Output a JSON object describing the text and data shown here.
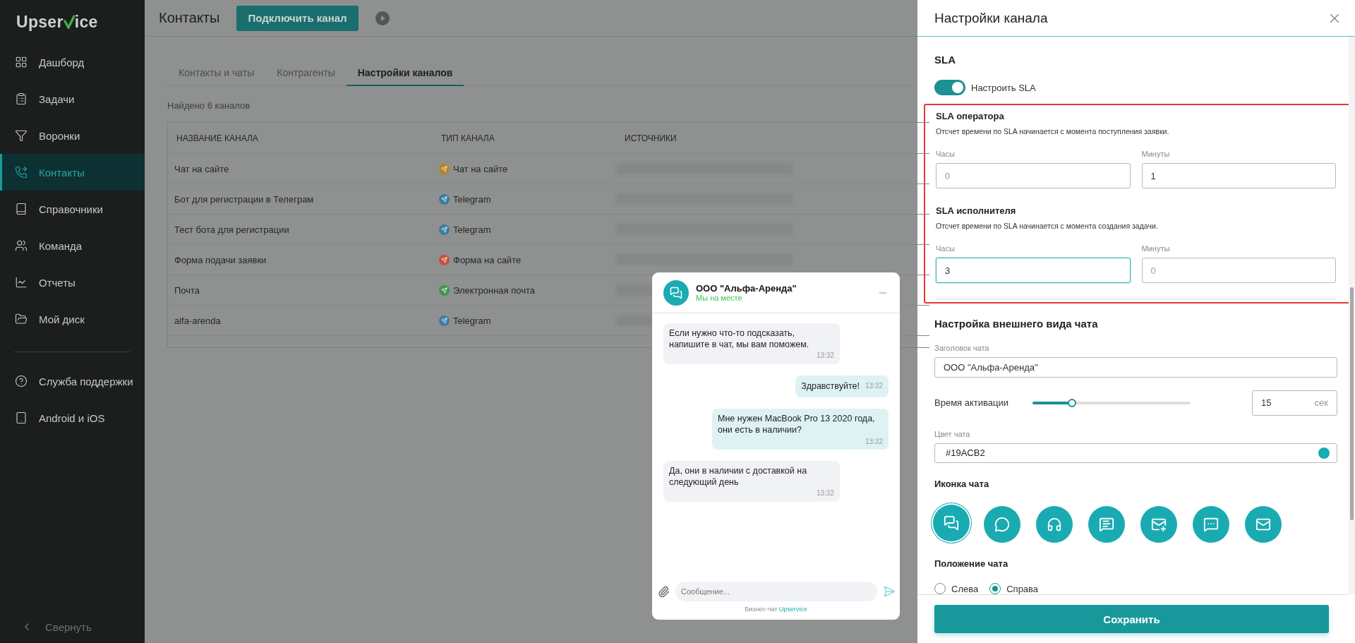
{
  "sidebar": {
    "logo": {
      "before": "Upser",
      "after": "ice"
    },
    "items": [
      {
        "label": "Дашборд",
        "selected": false
      },
      {
        "label": "Задачи",
        "selected": false
      },
      {
        "label": "Воронки",
        "selected": false
      },
      {
        "label": "Контакты",
        "selected": true
      },
      {
        "label": "Справочники",
        "selected": false
      },
      {
        "label": "Команда",
        "selected": false
      },
      {
        "label": "Отчеты",
        "selected": false
      },
      {
        "label": "Мой диск",
        "selected": false
      }
    ],
    "extra_items": [
      {
        "label": "Служба поддержки",
        "selected": false
      },
      {
        "label": "Android и iOS",
        "selected": false
      }
    ],
    "collapse": "Свернуть"
  },
  "header": {
    "title": "Контакты",
    "connect_button": "Подключить канал"
  },
  "tabs": [
    {
      "label": "Контакты и чаты",
      "selected": false
    },
    {
      "label": "Контрагенты",
      "selected": false
    },
    {
      "label": "Настройки каналов",
      "selected": true
    }
  ],
  "found": "Найдено 6 каналов",
  "table": {
    "columns": [
      "НАЗВАНИЕ КАНАЛА",
      "ТИП КАНАЛА",
      "ИСТОЧНИКИ"
    ],
    "rows": [
      {
        "name": "Чат на сайте",
        "type": "Чат на сайте",
        "color": "#b9831f",
        "sources_hidden": true
      },
      {
        "name": "Бот для регистрации в Телеграм",
        "type": "Telegram",
        "color": "#3a7ca6",
        "sources_hidden": true
      },
      {
        "name": "Тест бота для регистрации",
        "type": "Telegram",
        "color": "#3a7ca6",
        "sources_hidden": true
      },
      {
        "name": "Форма подачи заявки",
        "type": "Форма на сайте",
        "color": "#c0553a",
        "sources_hidden": true
      },
      {
        "name": "Почта",
        "type": "Электронная почта",
        "color": "#3f9650",
        "sources_hidden": true
      },
      {
        "name": "alfa-arenda",
        "type": "Telegram",
        "color": "#3a7ca6",
        "sources_hidden": true
      }
    ]
  },
  "chat_preview": {
    "name": "ООО \"Альфа-Аренда\"",
    "status": "Мы на месте",
    "messages": [
      {
        "kind": "agent",
        "text": "Если нужно что-то подсказать, напишите в чат, мы вам поможем.",
        "time": "13:32"
      },
      {
        "kind": "user",
        "text": "Здравствуйте!",
        "time": "13:32"
      },
      {
        "kind": "user",
        "text": "Мне нужен MacBook Pro 13 2020 года, они есть в наличии?",
        "time": "13:32"
      },
      {
        "kind": "agent",
        "text": "Да, они в наличии с доставкой на следующий день",
        "time": "13:32"
      }
    ],
    "input_placeholder": "Сообщение...",
    "footer": "Бизнес-чат",
    "footer_link": "Upservice"
  },
  "panel": {
    "title": "Настройки канала",
    "sla": {
      "heading": "SLA",
      "toggle": {
        "label": "Настроить SLA",
        "on": true
      },
      "highlighted": true,
      "groups": [
        {
          "title": "SLA оператора",
          "hint": "Отсчет времени по SLA начинается с момента поступления заявки.",
          "fields": [
            {
              "label": "Часы",
              "placeholder": "0",
              "focused": false
            },
            {
              "label": "Минуты",
              "value": "1",
              "focused": false
            }
          ]
        },
        {
          "title": "SLA исполнителя",
          "hint": "Отсчет времени по SLA начинается с момента создания задачи.",
          "fields": [
            {
              "label": "Часы",
              "value": "3",
              "focused": true
            },
            {
              "label": "Минуты",
              "placeholder": "0",
              "focused": false
            }
          ]
        }
      ]
    },
    "appearance": {
      "heading": "Настройка внешнего вида чата",
      "title_field": {
        "label": "Заголовок чата",
        "value": "ООО \"Альфа-Аренда\""
      },
      "activation": {
        "label": "Время активации",
        "level": 0.25,
        "value": "15",
        "unit": "сек"
      },
      "color_field": {
        "label": "Цвет чата",
        "value": "#19ACB2",
        "color": "#19acb2"
      },
      "icons_heading": "Иконка чата",
      "icons": [
        {
          "selected": true
        },
        {
          "selected": false
        },
        {
          "selected": false
        },
        {
          "selected": false
        },
        {
          "selected": false
        },
        {
          "selected": false
        },
        {
          "selected": false
        }
      ],
      "position_heading": "Положение чата",
      "positions": [
        {
          "label": "Слева",
          "selected": false
        },
        {
          "label": "Справа",
          "selected": true
        }
      ]
    },
    "save_button": "Сохранить"
  }
}
